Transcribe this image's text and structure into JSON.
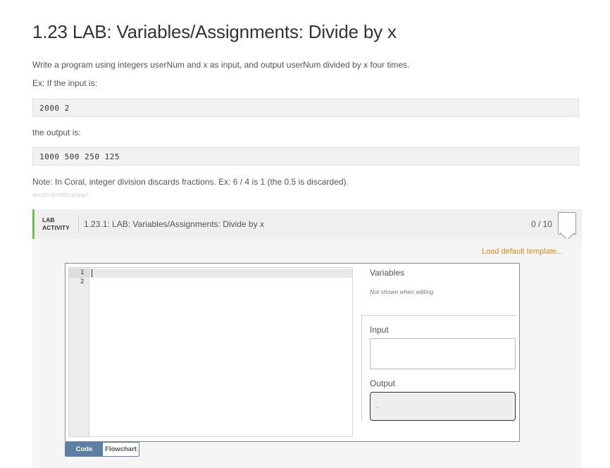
{
  "page": {
    "title": "1.23 LAB: Variables/Assignments: Divide by x",
    "description": "Write a program using integers userNum and x as input, and output userNum divided by x four times.",
    "example_intro": "Ex: If the input is:",
    "example_input": "2000 2",
    "output_intro": "the output is:",
    "example_output": "1000 500 250 125",
    "note": "Note: In Coral, integer division discards fractions. Ex: 6 / 4 is 1 (the 0.5 is discarded).",
    "tiny_id": "481160.1679680.qx3zqy7"
  },
  "lab": {
    "badge_line1": "LAB",
    "badge_line2": "ACTIVITY",
    "title": "1.23.1: LAB: Variables/Assignments: Divide by x",
    "score": "0 / 10",
    "load_template": "Load default template...",
    "accent_color": "#6cbf4c"
  },
  "editor": {
    "line_numbers": [
      "1",
      "2"
    ]
  },
  "panel": {
    "variables_title": "Variables",
    "variables_note": "Not shown when editing",
    "input_label": "Input",
    "input_value": "",
    "output_label": "Output",
    "output_value": "_"
  },
  "tabs": {
    "code": "Code",
    "flowchart": "Flowchart",
    "active": "Code",
    "active_color": "#5c7fa3"
  }
}
